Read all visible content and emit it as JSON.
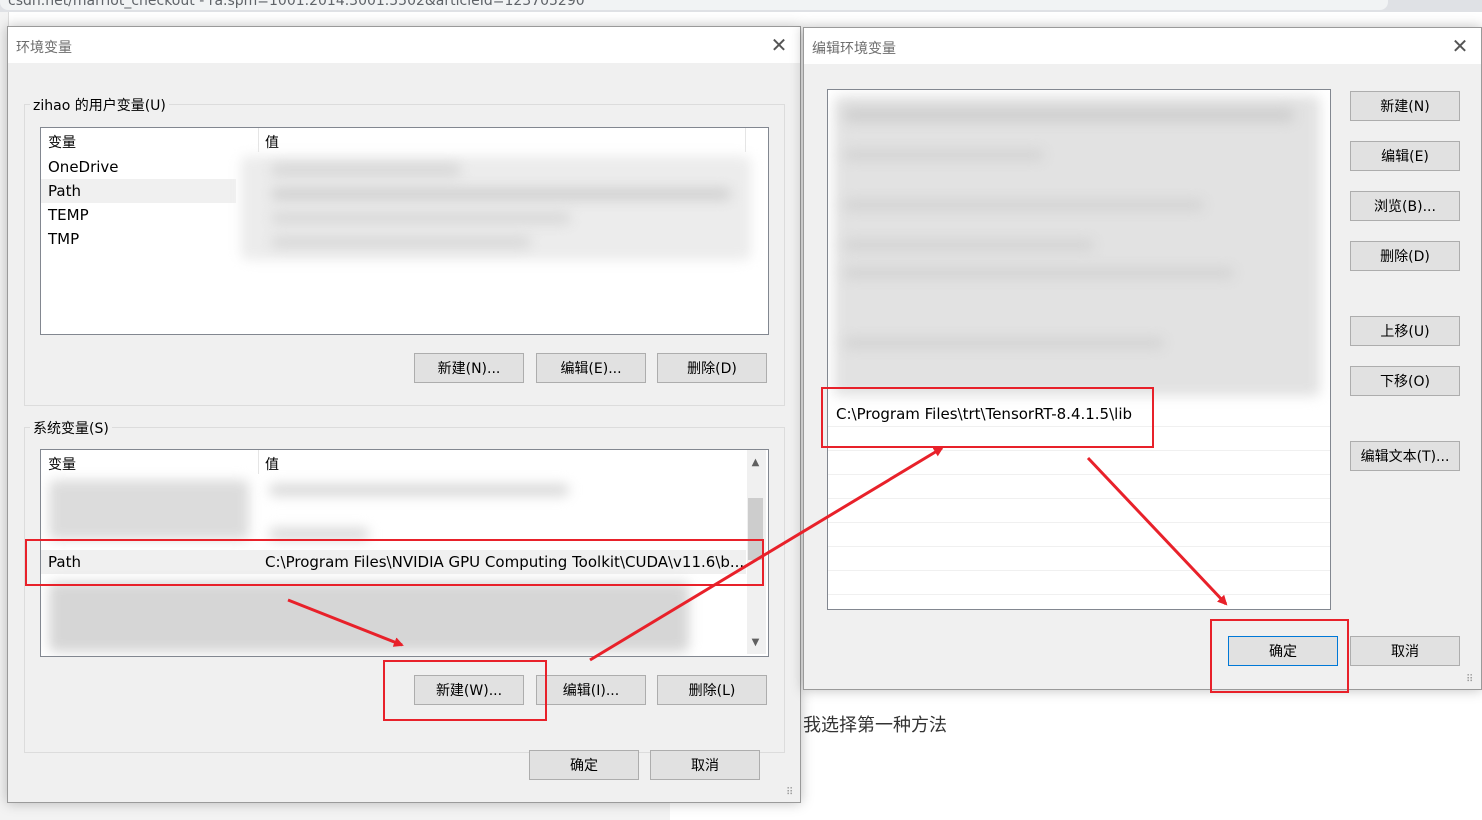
{
  "browser": {
    "url_fragment": "csdn.net/marriot_checkout  - ra.spm=1001.2014.3001.5502&articleId=123705290"
  },
  "article": {
    "caption": "我选择第一种方法"
  },
  "env_dialog": {
    "title": "环境变量",
    "user_group_label": "zihao 的用户变量(U)",
    "system_group_label": "系统变量(S)",
    "columns": {
      "name": "变量",
      "value": "值"
    },
    "user_vars": [
      {
        "name": "OneDrive",
        "value": ""
      },
      {
        "name": "Path",
        "value": ""
      },
      {
        "name": "TEMP",
        "value": ""
      },
      {
        "name": "TMP",
        "value": ""
      }
    ],
    "system_vars": [
      {
        "name": "Path",
        "value": "C:\\Program Files\\NVIDIA GPU Computing Toolkit\\CUDA\\v11.6\\b..."
      }
    ],
    "user_buttons": {
      "new": "新建(N)...",
      "edit": "编辑(E)...",
      "delete": "删除(D)"
    },
    "system_buttons": {
      "new": "新建(W)...",
      "edit": "编辑(I)...",
      "delete": "删除(L)"
    },
    "ok": "确定",
    "cancel": "取消"
  },
  "edit_dialog": {
    "title": "编辑环境变量",
    "new_entry": "C:\\Program Files\\trt\\TensorRT-8.4.1.5\\lib",
    "buttons": {
      "new": "新建(N)",
      "edit": "编辑(E)",
      "browse": "浏览(B)...",
      "delete": "删除(D)",
      "move_up": "上移(U)",
      "move_down": "下移(O)",
      "edit_text": "编辑文本(T)...",
      "ok": "确定",
      "cancel": "取消"
    }
  },
  "colors": {
    "annotation": "#e8212a",
    "dialog_bg": "#f0f0f0",
    "button_bg": "#e1e1e1",
    "selection": "#f0f0f0"
  },
  "icons": {
    "close": "close-icon",
    "scroll_up": "chevron-up-icon",
    "scroll_down": "chevron-down-icon",
    "resize": "resize-grip-icon"
  }
}
